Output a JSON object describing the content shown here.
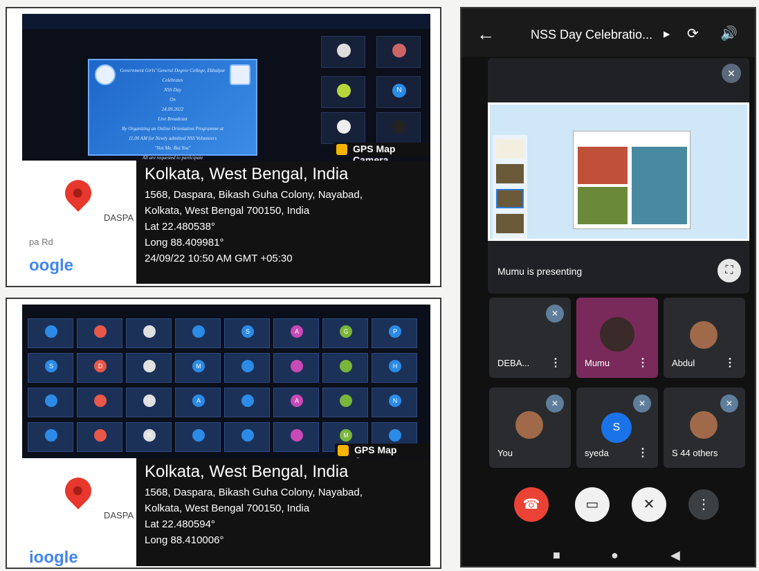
{
  "top_left": {
    "gps_badge": "GPS Map Camera",
    "place_title": "Kolkata, West Bengal, India",
    "address_line1": "1568, Daspara, Bikash Guha Colony, Nayabad,",
    "address_line2": "Kolkata, West Bengal 700150, India",
    "lat": "Lat 22.480538°",
    "long": "Long 88.409981°",
    "datetime": "24/09/22 10:50 AM GMT +05:30",
    "map_label_daspara": "DASPA",
    "map_label_road": "pa Rd",
    "map_brand": "oogle",
    "slide_lines": [
      "Government Girls' General Degree College, Ekbalpur",
      "Celebrates",
      "NSS Day",
      "On",
      "24.09.2022",
      "Live Broadcast",
      "By Organizing an Online Orientation Programme at 11.00 AM for Newly admitted NSS Volunteers",
      "\"Not Me, But You\"",
      "All are requested to participate"
    ],
    "side_tiles": [
      "",
      "",
      "",
      "N",
      "",
      ""
    ]
  },
  "bottom_left": {
    "gps_badge": "GPS Map Camera",
    "place_title": "Kolkata, West Bengal, India",
    "address_line1": "1568, Daspara, Bikash Guha Colony, Nayabad,",
    "address_line2": "Kolkata, West Bengal 700150, India",
    "lat": "Lat 22.480594°",
    "long": "Long 88.410006°",
    "map_label_daspara": "DASPA",
    "map_brand": "ioogle",
    "grid_avatars": [
      "",
      "",
      "",
      "",
      "S",
      "A",
      "G",
      "P",
      "S",
      "D",
      "",
      "M",
      "",
      "",
      "",
      "H",
      "",
      "",
      "f",
      "A",
      "",
      "A",
      "",
      "N",
      "",
      "",
      "R",
      "",
      "",
      "",
      "M",
      ""
    ]
  },
  "phone": {
    "title": "NSS Day Celebratio...",
    "presenting_label": "Mumu is presenting",
    "tiles": [
      {
        "name": "DEBA...",
        "kind": "muted"
      },
      {
        "name": "Mumu",
        "kind": "video"
      },
      {
        "name": "Abdul",
        "kind": "photo"
      },
      {
        "name": "You",
        "kind": "photo-muted"
      },
      {
        "name": "syeda",
        "kind": "initial",
        "initial": "S"
      },
      {
        "name": "44 others",
        "prefix": "S",
        "kind": "photo-muted"
      }
    ],
    "colors": {
      "end_call": "#ea4335",
      "tile_bg": "#2a2b2e",
      "accent": "#1a73e8"
    }
  }
}
